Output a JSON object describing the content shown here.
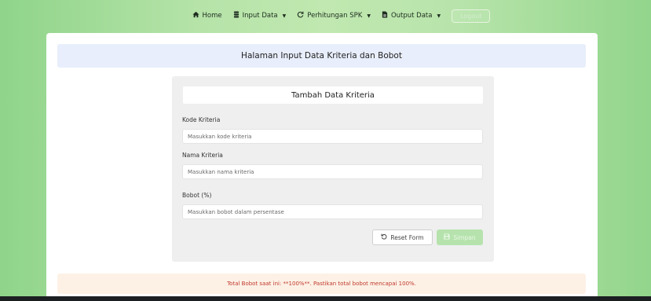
{
  "nav": {
    "home": {
      "label": "Home",
      "icon": "home-icon"
    },
    "input_data": {
      "label": "Input Data",
      "icon": "database-icon"
    },
    "perhitungan": {
      "label": "Perhitungan SPK",
      "icon": "refresh-icon"
    },
    "output_data": {
      "label": "Output Data",
      "icon": "file-icon"
    },
    "logout": {
      "label": "Logout"
    }
  },
  "page": {
    "title": "Halaman Input Data Kriteria dan Bobot"
  },
  "form": {
    "title": "Tambah Data Kriteria",
    "kode": {
      "label": "Kode Kriteria",
      "placeholder": "Masukkan kode kriteria",
      "value": ""
    },
    "nama": {
      "label": "Nama Kriteria",
      "placeholder": "Masukkan nama kriteria",
      "value": ""
    },
    "bobot": {
      "label": "Bobot (%)",
      "placeholder": "Masukkan bobot dalam persentase",
      "value": ""
    },
    "reset_label": "Reset Form",
    "save_label": "Simpan"
  },
  "alert": {
    "text": "Total Bobot saat ini: **100%**. Pastikan total bobot mencapai 100%."
  },
  "colors": {
    "accent": "#b6e3ad",
    "header_bg": "#e8eefb",
    "alert_text": "#c0392b"
  }
}
